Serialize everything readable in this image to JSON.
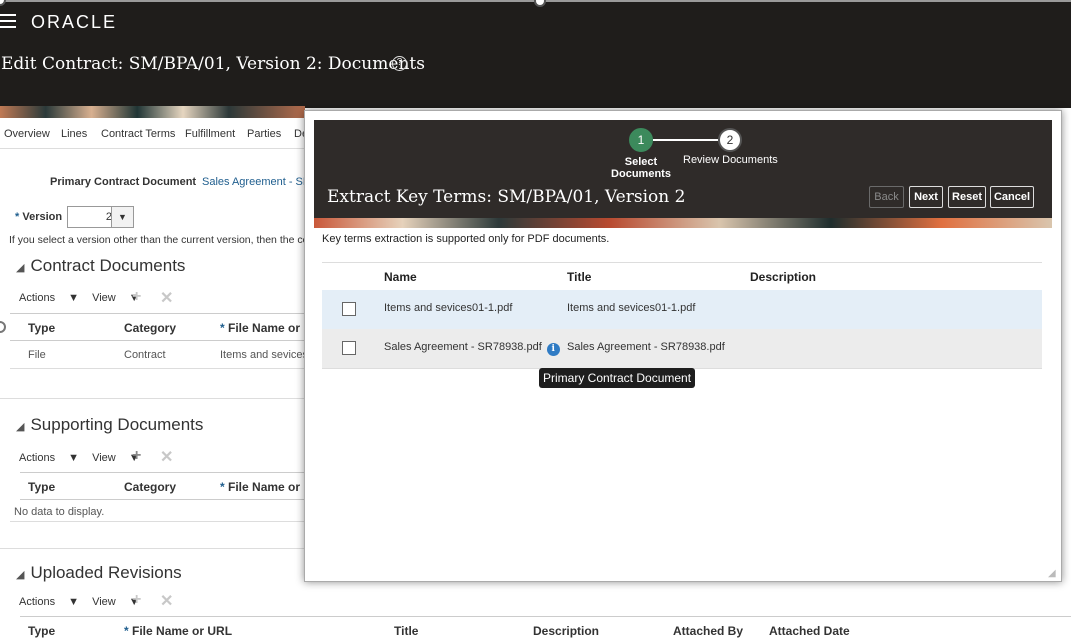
{
  "header": {
    "brand": "ORACLE",
    "page_title": "Edit Contract: SM/BPA/01, Version 2: Documents",
    "help_glyph": "?"
  },
  "tabs": [
    "Overview",
    "Lines",
    "Contract Terms",
    "Fulfillment",
    "Parties",
    "De"
  ],
  "primary_doc": {
    "label": "Primary Contract Document",
    "value": "Sales Agreement - SR"
  },
  "version": {
    "label": "Version",
    "value": "2",
    "note": "If you select a version other than the current version, then the co"
  },
  "toolbar": {
    "actions": "Actions",
    "view": "View"
  },
  "contract_documents": {
    "title": "Contract Documents",
    "columns": [
      "Type",
      "Category",
      "File Name or U"
    ],
    "rows": [
      [
        "File",
        "Contract",
        "Items and sevices"
      ]
    ]
  },
  "supporting_documents": {
    "title": "Supporting Documents",
    "columns": [
      "Type",
      "Category",
      "File Name or U"
    ],
    "empty": "No data to display."
  },
  "uploaded_revisions": {
    "title": "Uploaded Revisions",
    "columns": [
      "Type",
      "File Name or URL",
      "Title",
      "Description",
      "Attached By",
      "Attached Date"
    ]
  },
  "modal": {
    "steps": [
      {
        "number": "1",
        "label": "Select\nDocuments"
      },
      {
        "number": "2",
        "label": "Review Documents"
      }
    ],
    "title": "Extract Key Terms: SM/BPA/01, Version 2",
    "buttons": {
      "back": "Back",
      "next": "Next",
      "reset": "Reset",
      "cancel": "Cancel"
    },
    "info": "Key terms extraction is supported only for PDF documents.",
    "columns": [
      "Name",
      "Title",
      "Description"
    ],
    "rows": [
      {
        "name": "Items and sevices01-1.pdf",
        "title": "Items and sevices01-1.pdf",
        "description": ""
      },
      {
        "name": "Sales Agreement - SR78938.pdf",
        "title": "Sales Agreement - SR78938.pdf",
        "description": ""
      }
    ],
    "tooltip": "Primary Contract Document",
    "info_glyph": "i"
  },
  "colors": {
    "header_bg": "#1f1d1b",
    "modal_header_bg": "#2f2b29",
    "step_active": "#3c8a5c",
    "link": "#1f5e8e",
    "selected_row": "#e4eef7",
    "info_icon": "#2f7bc4"
  },
  "icons": [
    "hamburger-icon",
    "help-icon",
    "add-icon",
    "delete-icon",
    "collapse-triangle-icon",
    "info-icon",
    "dropdown-arrow-icon",
    "resize-handle-icon"
  ]
}
